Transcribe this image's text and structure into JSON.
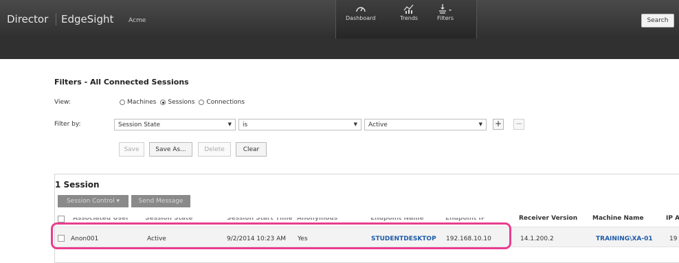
{
  "header": {
    "product": "Director",
    "module": "EdgeSight",
    "site": "Acme",
    "nav": [
      {
        "label": "Dashboard",
        "icon": "gauge-icon"
      },
      {
        "label": "Trends",
        "icon": "trends-chart-icon"
      },
      {
        "label": "Filters",
        "icon": "filter-icon"
      }
    ],
    "search_label": "Search"
  },
  "filters": {
    "title": "Filters - All Connected Sessions",
    "view_label": "View:",
    "view_options": [
      "Machines",
      "Sessions",
      "Connections"
    ],
    "view_selected": "Sessions",
    "filter_by_label": "Filter by:",
    "field": "Session State",
    "operator": "is",
    "value": "Active",
    "add_label": "+",
    "remove_label": "−",
    "buttons": {
      "save": "Save",
      "save_as": "Save As...",
      "delete": "Delete",
      "clear": "Clear"
    }
  },
  "sessions": {
    "count_title": "1 Session",
    "session_control_label": "Session Control ▾",
    "send_message_label": "Send Message",
    "columns": [
      "Associated User",
      "Session State",
      "Session Start Time",
      "Anonymous",
      "Endpoint Name",
      "Endpoint IP",
      "Receiver Version",
      "Machine Name",
      "IP A"
    ],
    "rows": [
      {
        "user": "Anon001",
        "state": "Active",
        "start_time": "9/2/2014 10:23 AM",
        "anonymous": "Yes",
        "endpoint_name": "STUDENTDESKTOP",
        "endpoint_ip": "192.168.10.10",
        "receiver_version": "14.1.200.2",
        "machine_name": "TRAINING\\XA-01",
        "ip_partial": "19"
      }
    ]
  },
  "colors": {
    "topbar": "#2f2f2f",
    "link": "#1e5aa8",
    "highlight": "#ea3c8f"
  }
}
